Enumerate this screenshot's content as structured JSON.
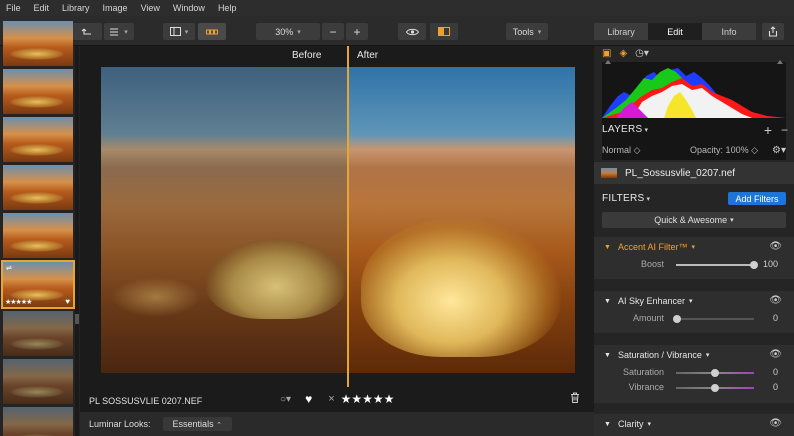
{
  "menu": [
    "File",
    "Edit",
    "Library",
    "Image",
    "View",
    "Window",
    "Help"
  ],
  "toolbar": {
    "zoom": "30%",
    "zoom_minus": "−",
    "zoom_plus": "+",
    "tools_label": "Tools",
    "tabs": [
      {
        "label": "Library",
        "selected": false
      },
      {
        "label": "Edit",
        "selected": true
      },
      {
        "label": "Info",
        "selected": false
      }
    ]
  },
  "filmstrip": {
    "selected_rating": "★★★★★",
    "selected_heart": "♥"
  },
  "canvas": {
    "before_label": "Before",
    "after_label": "After",
    "filename": "PL SOSSUSVLIE 0207.NEF",
    "rating": "★★★★★",
    "heart": "♥",
    "reject": "×"
  },
  "looks": {
    "label": "Luminar Looks:",
    "selected": "Essentials"
  },
  "panel": {
    "layers_title": "LAYERS",
    "blend_mode": "Normal",
    "opacity": "Opacity: 100%",
    "layer_name": "PL_Sossusvlie_0207.nef",
    "filters_title": "FILTERS",
    "add_filters": "Add Filters",
    "quick_awesome": "Quick & Awesome",
    "filters": [
      {
        "name": "Accent AI Filter™",
        "active": true,
        "sliders": [
          {
            "label": "Boost",
            "value": "100",
            "pct": 1.0
          }
        ]
      },
      {
        "name": "AI Sky Enhancer",
        "active": false,
        "sliders": [
          {
            "label": "Amount",
            "value": "0",
            "pct": 0.0
          }
        ]
      },
      {
        "name": "Saturation / Vibrance",
        "active": false,
        "sliders": [
          {
            "label": "Saturation",
            "value": "0",
            "pct": 0.5
          },
          {
            "label": "Vibrance",
            "value": "0",
            "pct": 0.5
          }
        ]
      },
      {
        "name": "Clarity",
        "active": false,
        "sliders": []
      }
    ]
  },
  "colors": {
    "accent": "#e6a535",
    "button_blue": "#1f75d6"
  }
}
